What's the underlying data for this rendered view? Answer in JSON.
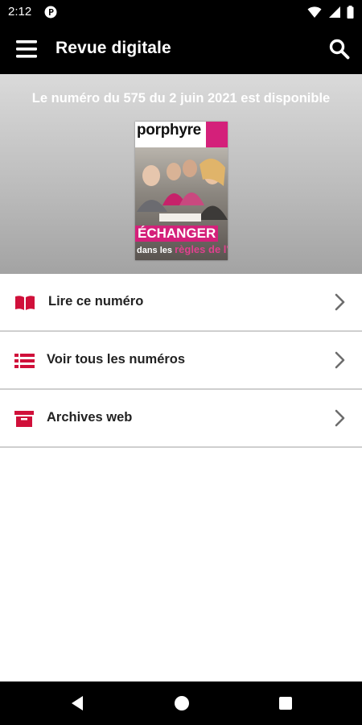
{
  "status_bar": {
    "time": "2:12"
  },
  "app_bar": {
    "title": "Revue digitale"
  },
  "hero": {
    "title": "Le numéro du 575 du 2 juin 2021 est disponible",
    "cover": {
      "brand": "porphyre",
      "headline": "ÉCHANGER",
      "subline_prefix": "dans les",
      "subline_pink": "règles de l'art"
    }
  },
  "menu": {
    "items": [
      {
        "label": "Lire ce numéro",
        "icon": "book-open-icon"
      },
      {
        "label": "Voir tous les numéros",
        "icon": "list-icon"
      },
      {
        "label": "Archives web",
        "icon": "archive-box-icon"
      }
    ]
  },
  "colors": {
    "accent": "#d0103a",
    "status_bar": "#000000",
    "app_bar": "#000000",
    "divider": "#cfcfcf",
    "cover_pink": "#d4207a"
  }
}
